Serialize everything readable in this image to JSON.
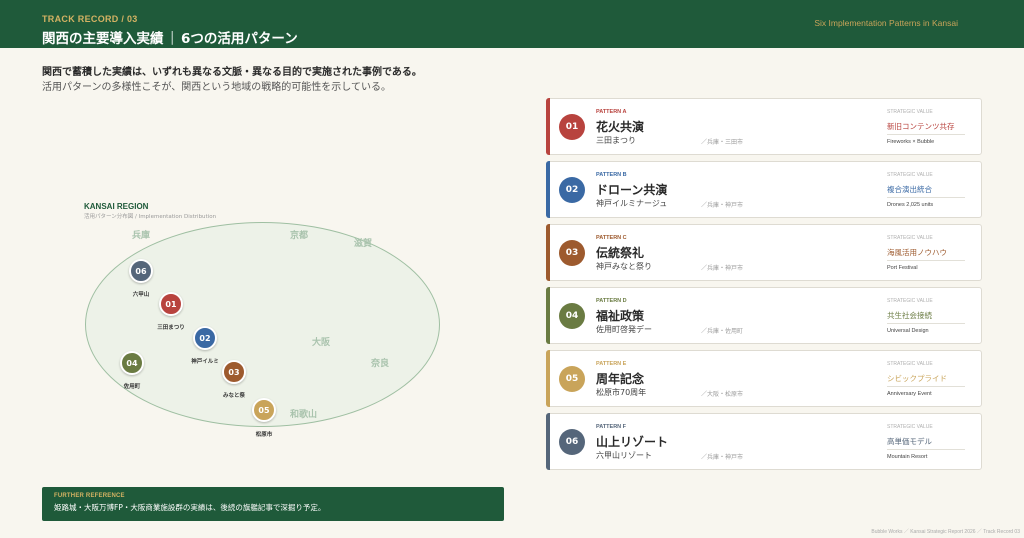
{
  "header": {
    "kicker": "TRACK RECORD / 03",
    "title_main": "関西の主要導入実績",
    "title_sep": "｜",
    "title_sub": "6つの活用パターン",
    "english": "Six Implementation Patterns in Kansai"
  },
  "lead": {
    "line1": "関西で蓄積した実績は、いずれも異なる文脈・異なる目的で実施された事例である。",
    "line2": "活用パターンの多様性こそが、関西という地域の戦略的可能性を示している。"
  },
  "map": {
    "title": "KANSAI REGION",
    "subtitle": "活用パターン分布図 / Implementation Distribution",
    "regions": [
      "兵庫",
      "京都",
      "滋賀",
      "大阪",
      "奈良",
      "和歌山"
    ],
    "pins": [
      {
        "num": "06",
        "label": "六甲山",
        "color": "#55667a"
      },
      {
        "num": "01",
        "label": "三田まつり",
        "color": "#b8433e"
      },
      {
        "num": "02",
        "label": "神戸イルミ",
        "color": "#3a69a4"
      },
      {
        "num": "04",
        "label": "佐用町",
        "color": "#6a7b42"
      },
      {
        "num": "03",
        "label": "みなと祭",
        "color": "#9d5a2e"
      },
      {
        "num": "05",
        "label": "松原市",
        "color": "#c9a45a"
      }
    ]
  },
  "further": {
    "kicker": "FURTHER REFERENCE",
    "text": "姫路城・大阪万博FP・大阪商業施設群の実績は、後続の旗艦記事で深掘り予定。"
  },
  "cards": [
    {
      "num": "01",
      "pattern": "PATTERN A",
      "name": "花火共演",
      "event": "三田まつり",
      "location": "／兵庫・三田市",
      "sv_label": "STRATEGIC VALUE",
      "value": "新旧コンテンツ共存",
      "en": "Fireworks × Bubble",
      "color": "#b8433e"
    },
    {
      "num": "02",
      "pattern": "PATTERN B",
      "name": "ドローン共演",
      "event": "神戸イルミナージュ",
      "location": "／兵庫・神戸市",
      "sv_label": "STRATEGIC VALUE",
      "value": "複合演出統合",
      "en": "Drones 2,025 units",
      "color": "#3a69a4"
    },
    {
      "num": "03",
      "pattern": "PATTERN C",
      "name": "伝統祭礼",
      "event": "神戸みなと祭り",
      "location": "／兵庫・神戸市",
      "sv_label": "STRATEGIC VALUE",
      "value": "海風活用ノウハウ",
      "en": "Port Festival",
      "color": "#9d5a2e"
    },
    {
      "num": "04",
      "pattern": "PATTERN D",
      "name": "福祉政策",
      "event": "佐用町啓発デー",
      "location": "／兵庫・佐用町",
      "sv_label": "STRATEGIC VALUE",
      "value": "共生社会接続",
      "en": "Universal Design",
      "color": "#6a7b42"
    },
    {
      "num": "05",
      "pattern": "PATTERN E",
      "name": "周年記念",
      "event": "松原市70周年",
      "location": "／大阪・松原市",
      "sv_label": "STRATEGIC VALUE",
      "value": "シビックプライド",
      "en": "Anniversary Event",
      "color": "#c9a45a"
    },
    {
      "num": "06",
      "pattern": "PATTERN F",
      "name": "山上リゾート",
      "event": "六甲山リゾート",
      "location": "／兵庫・神戸市",
      "sv_label": "STRATEGIC VALUE",
      "value": "高単価モデル",
      "en": "Mountain Resort",
      "color": "#55667a"
    }
  ],
  "footer": "Bubble Works ／ Kansai Strategic Report 2026 ／ Track Record 03"
}
